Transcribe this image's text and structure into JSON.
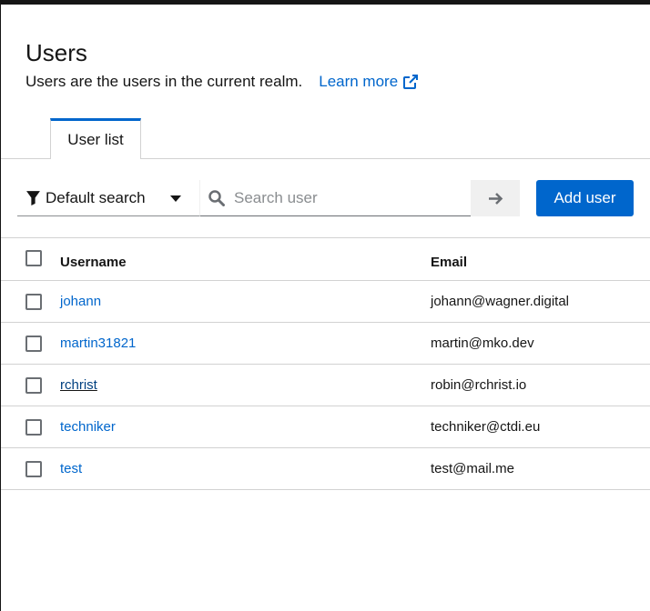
{
  "header": {
    "title": "Users",
    "description": "Users are the users in the current realm.",
    "learn_more": "Learn more"
  },
  "tabs": [
    {
      "label": "User list",
      "active": true
    }
  ],
  "toolbar": {
    "search_type": "Default search",
    "search_placeholder": "Search user",
    "add_user_label": "Add user"
  },
  "table": {
    "columns": [
      "Username",
      "Email"
    ],
    "rows": [
      {
        "username": "johann",
        "email": "johann@wagner.digital"
      },
      {
        "username": "martin31821",
        "email": "martin@mko.dev"
      },
      {
        "username": "rchrist",
        "email": "robin@rchrist.io"
      },
      {
        "username": "techniker",
        "email": "techniker@ctdi.eu"
      },
      {
        "username": "test",
        "email": "test@mail.me"
      }
    ]
  },
  "colors": {
    "accent": "#0066cc",
    "text": "#151515",
    "border": "#d2d2d2"
  },
  "icons": [
    "external-link-icon",
    "filter-icon",
    "caret-down-icon",
    "search-icon",
    "arrow-right-icon"
  ]
}
